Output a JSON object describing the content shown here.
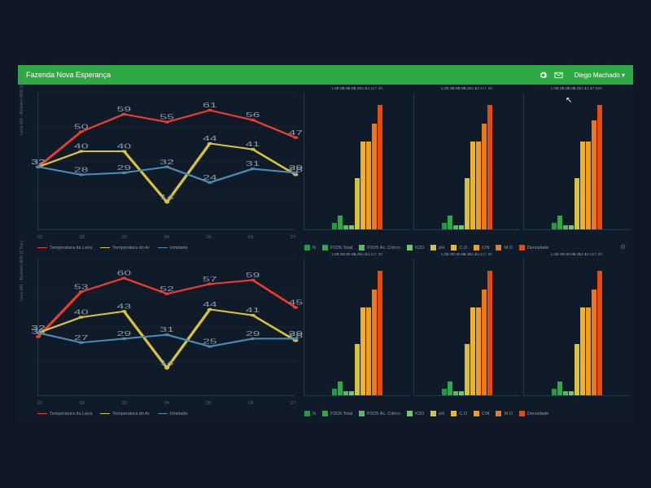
{
  "header": {
    "title": "Fazenda Nova Esperança",
    "user": "Diego Machado",
    "user_caret": "▾",
    "icons": [
      "gear-icon",
      "mail-icon"
    ]
  },
  "colors": {
    "header_bg": "#2fa945",
    "bg": "#101b29",
    "red": "#ef3b2c",
    "yellow": "#d8c23a",
    "blue": "#4a8bb5",
    "bar_palette": [
      "#1f9e3d",
      "#2fa945",
      "#4fbf5a",
      "#70c96b",
      "#d8c23a",
      "#f0b229",
      "#f59a1f",
      "#f07818",
      "#e84c0d",
      "#d8291a"
    ]
  },
  "line_legend": [
    {
      "label": "Temperatura da Leira",
      "color": "#ef3b2c"
    },
    {
      "label": "Temperatura do Ar",
      "color": "#d8c23a"
    },
    {
      "label": "Umidade",
      "color": "#4a8bb5"
    }
  ],
  "bar_legend": [
    {
      "label": "N",
      "color": "#1f9e3d"
    },
    {
      "label": "P2O5 Total",
      "color": "#2fa945"
    },
    {
      "label": "P2O5 Ác. Cítrico",
      "color": "#4fbf5a"
    },
    {
      "label": "K2O",
      "color": "#70c96b"
    },
    {
      "label": "pH",
      "color": "#d8c23a"
    },
    {
      "label": "C.O",
      "color": "#f0b229"
    },
    {
      "label": "C/N",
      "color": "#f59a1f"
    },
    {
      "label": "M.O",
      "color": "#f07818"
    },
    {
      "label": "Densidade",
      "color": "#e84c0d"
    }
  ],
  "chart_data": [
    {
      "id": "line-top",
      "type": "line",
      "ylabel": "Leira 001 - Biochem 90% (1 Ton.)",
      "x": [
        "D1",
        "D2",
        "D3",
        "D4",
        "D5",
        "D6",
        "D7"
      ],
      "ylim": [
        0,
        70
      ],
      "series": [
        {
          "name": "Temperatura da Leira",
          "color": "#ef3b2c",
          "values": [
            32,
            50,
            59,
            55,
            61,
            56,
            47
          ]
        },
        {
          "name": "Temperatura do Ar",
          "color": "#d8c23a",
          "values": [
            32,
            40,
            40,
            14,
            44,
            41,
            28
          ]
        },
        {
          "name": "Umidade",
          "color": "#4a8bb5",
          "values": [
            32,
            28,
            29,
            32,
            24,
            31,
            29
          ]
        }
      ]
    },
    {
      "id": "bar-top-1",
      "type": "bar",
      "ylim": [
        0,
        22
      ],
      "categories": [
        "N",
        "P2O5 Total",
        "P2O5 Ác. Cítrico",
        "K2O",
        "pH",
        "C.O",
        "C/N",
        "M.O",
        "Densidade"
      ],
      "values": [
        1.02,
        2.25,
        0.65,
        0.65,
        8.25,
        14.1,
        14.1,
        17.0,
        20.0
      ]
    },
    {
      "id": "bar-top-2",
      "type": "bar",
      "ylim": [
        0,
        22
      ],
      "categories": [
        "N",
        "P2O5 Total",
        "P2O5 Ác. Cítrico",
        "K2O",
        "pH",
        "C.O",
        "C/N",
        "M.O",
        "Densidade"
      ],
      "values": [
        1.02,
        2.25,
        0.65,
        0.65,
        8.25,
        14.1,
        14.1,
        17.0,
        20.0
      ]
    },
    {
      "id": "bar-top-3",
      "type": "bar",
      "ylim": [
        0,
        22
      ],
      "categories": [
        "N",
        "P2O5 Total",
        "P2O5 Ác. Cítrico",
        "K2O",
        "pH",
        "C.O",
        "C/N",
        "M.O",
        "Densidade"
      ],
      "values": [
        1.02,
        2.25,
        0.65,
        0.65,
        8.25,
        14.1,
        14.1,
        17.6,
        20.0
      ]
    },
    {
      "id": "line-bottom",
      "type": "line",
      "ylabel": "Leira 001 - Biochem 90% (1 Ton.)",
      "x": [
        "D1",
        "D2",
        "D3",
        "D4",
        "D5",
        "D6",
        "D7"
      ],
      "ylim": [
        0,
        70
      ],
      "series": [
        {
          "name": "Temperatura da Leira",
          "color": "#ef3b2c",
          "values": [
            30,
            53,
            60,
            52,
            57,
            59,
            45
          ]
        },
        {
          "name": "Temperatura do Ar",
          "color": "#d8c23a",
          "values": [
            32,
            40,
            43,
            14,
            44,
            41,
            28
          ]
        },
        {
          "name": "Umidade",
          "color": "#4a8bb5",
          "values": [
            32,
            27,
            29,
            31,
            25,
            29,
            29
          ]
        }
      ]
    },
    {
      "id": "bar-bot-1",
      "type": "bar",
      "ylim": [
        0,
        22
      ],
      "categories": [
        "N",
        "P2O5 Total",
        "P2O5 Ác. Cítrico",
        "K2O",
        "pH",
        "C.O",
        "C/N",
        "M.O",
        "Densidade"
      ],
      "values": [
        1.02,
        2.25,
        0.6,
        0.65,
        8.28,
        14.1,
        14.1,
        17.0,
        20.0
      ]
    },
    {
      "id": "bar-bot-2",
      "type": "bar",
      "ylim": [
        0,
        22
      ],
      "categories": [
        "N",
        "P2O5 Total",
        "P2O5 Ác. Cítrico",
        "K2O",
        "pH",
        "C.O",
        "C/N",
        "M.O",
        "Densidade"
      ],
      "values": [
        1.02,
        2.25,
        0.6,
        0.65,
        8.28,
        14.1,
        14.1,
        17.0,
        20.0
      ]
    },
    {
      "id": "bar-bot-3",
      "type": "bar",
      "ylim": [
        0,
        22
      ],
      "categories": [
        "N",
        "P2O5 Total",
        "P2O5 Ác. Cítrico",
        "K2O",
        "pH",
        "C.O",
        "C/N",
        "M.O",
        "Densidade"
      ],
      "values": [
        1.02,
        2.25,
        0.6,
        0.65,
        8.28,
        14.1,
        14.1,
        17.0,
        20.0
      ]
    }
  ]
}
